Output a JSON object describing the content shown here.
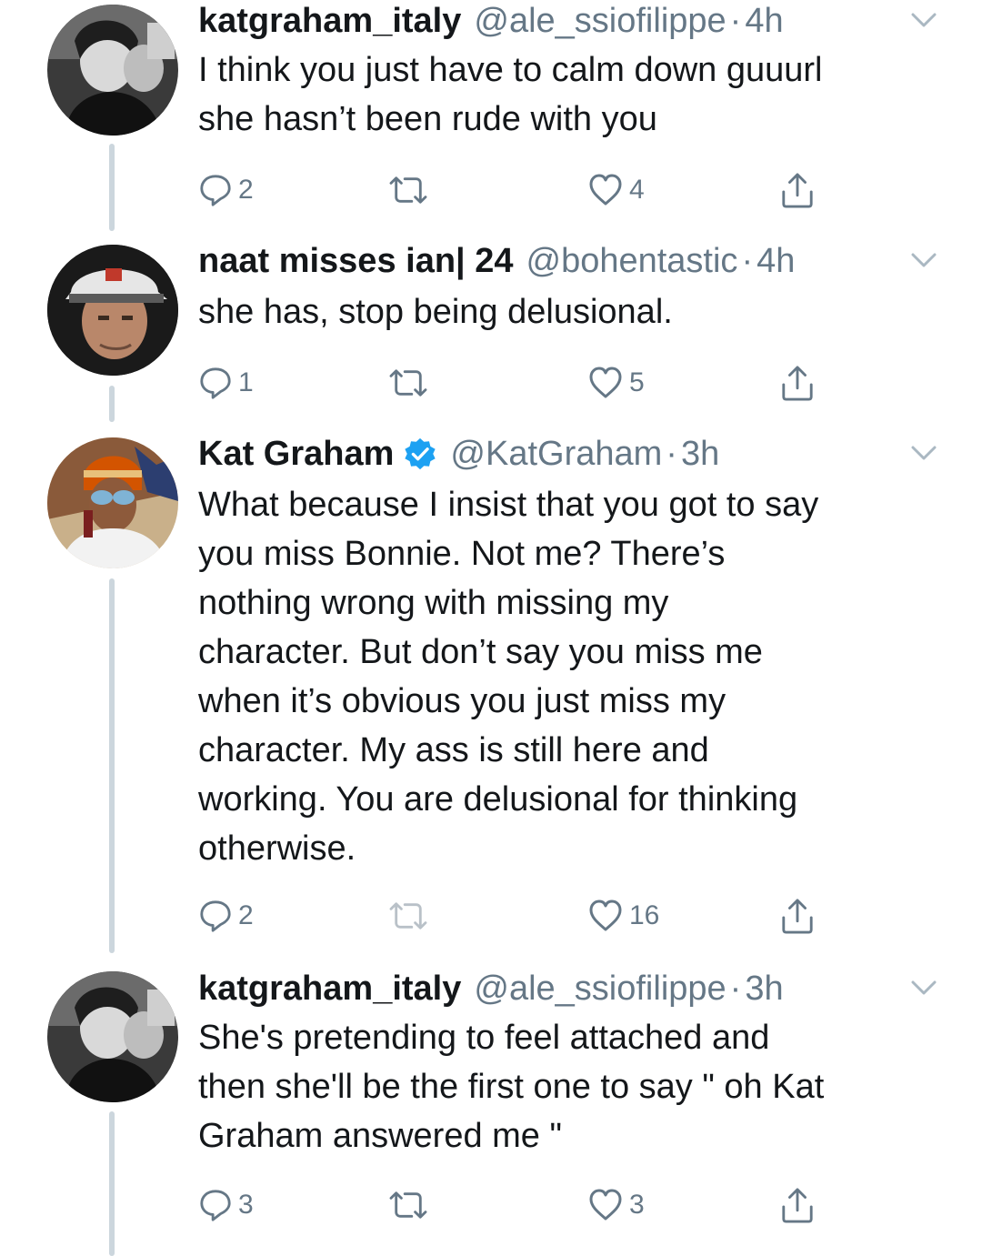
{
  "colors": {
    "text": "#14171a",
    "muted": "#657786",
    "line": "#ccd6dd",
    "verified": "#1da1f2"
  },
  "tweets": [
    {
      "name": "katgraham_italy",
      "handle": "@ale_ssiofilippe",
      "time": "4h",
      "verified": false,
      "text": [
        "I think you just have to calm down guuurl",
        "she hasn’t been rude with you"
      ],
      "replies": "2",
      "retweets": "",
      "likes": "4"
    },
    {
      "name": "naat misses ian| 24",
      "handle": "@bohentastic",
      "time": "4h",
      "verified": false,
      "text": [
        "she has, stop being delusional."
      ],
      "replies": "1",
      "retweets": "",
      "likes": "5"
    },
    {
      "name": "Kat Graham",
      "handle": "@KatGraham",
      "time": "3h",
      "verified": true,
      "text": [
        "What because I insist that you got to say",
        "you miss Bonnie. Not me? There’s",
        "nothing wrong with missing my",
        "character. But don’t say you miss me",
        "when it’s obvious you just miss my",
        "character. My ass is still here and",
        "working. You are delusional for thinking",
        "otherwise."
      ],
      "replies": "2",
      "retweets": "",
      "likes": "16"
    },
    {
      "name": "katgraham_italy",
      "handle": "@ale_ssiofilippe",
      "time": "3h",
      "verified": false,
      "text": [
        "She's pretending to feel attached and",
        "then she'll be the first one to say \" oh Kat",
        "Graham answered me \""
      ],
      "replies": "3",
      "retweets": "",
      "likes": "3"
    }
  ]
}
